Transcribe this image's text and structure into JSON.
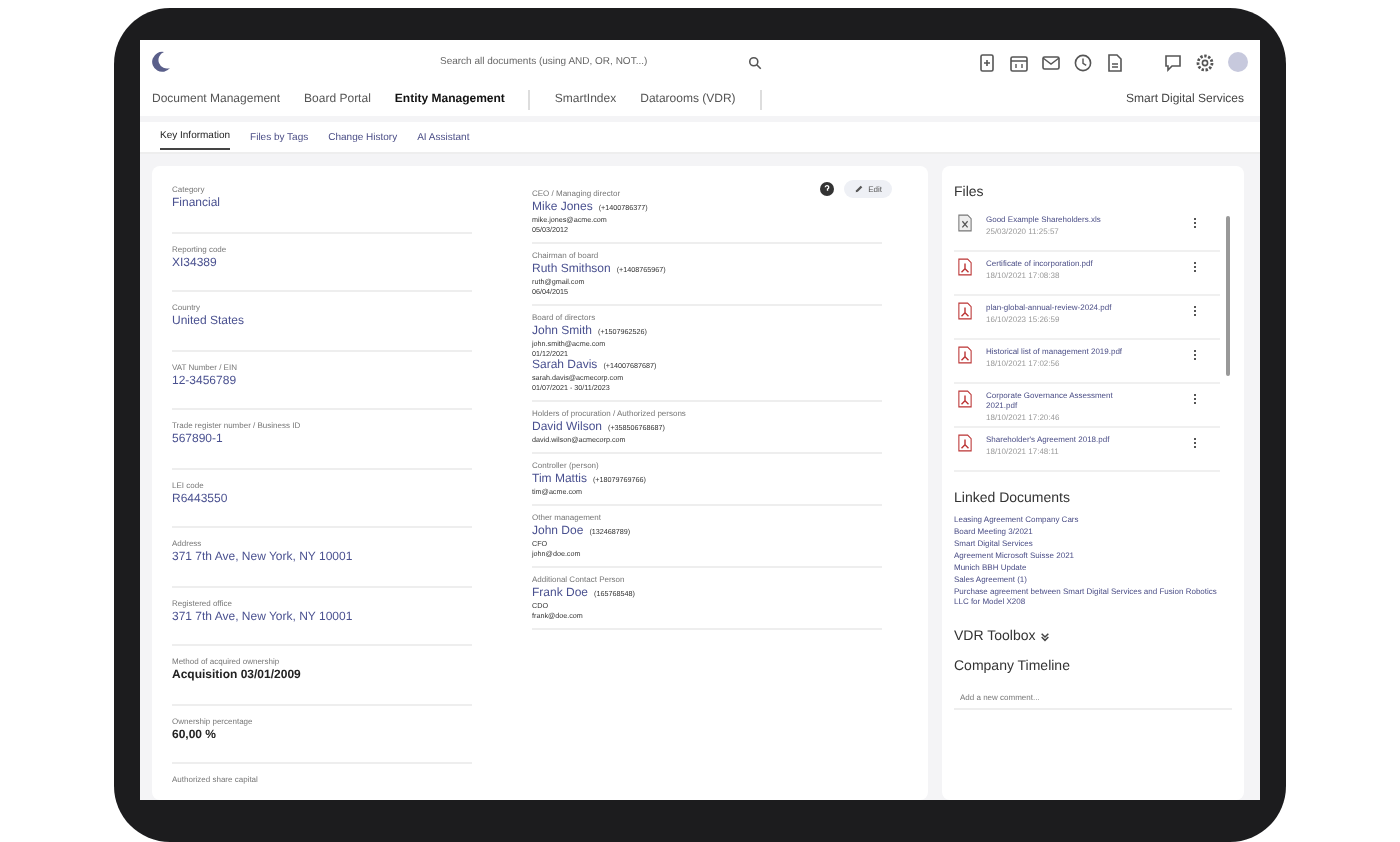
{
  "topbar": {
    "search": {
      "placeholder": "Search all documents (using AND, OR, NOT...)"
    },
    "company": "Smart Digital Services"
  },
  "nav": [
    {
      "label": "Document Management",
      "selected": false
    },
    {
      "label": "Board Portal",
      "selected": false
    },
    {
      "label": "Entity Management",
      "selected": true
    },
    {
      "label": "SmartIndex",
      "selected": false
    },
    {
      "label": "Datarooms (VDR)",
      "selected": false
    }
  ],
  "subtabs": [
    {
      "label": "Key Information",
      "selected": true
    },
    {
      "label": "Files by Tags",
      "selected": false
    },
    {
      "label": "Change History",
      "selected": false
    },
    {
      "label": "AI Assistant",
      "selected": false
    }
  ],
  "fields": [
    {
      "label": "Category",
      "value": "Financial",
      "kind": "link"
    },
    {
      "label": "Reporting code",
      "value": "XI34389",
      "kind": "link"
    },
    {
      "label": "Country",
      "value": "United States",
      "kind": "link"
    },
    {
      "label": "VAT Number / EIN",
      "value": "12-3456789",
      "kind": "link"
    },
    {
      "label": "Trade register number / Business ID",
      "value": "567890-1",
      "kind": "link"
    },
    {
      "label": "LEI code",
      "value": "R6443550",
      "kind": "link"
    },
    {
      "label": "Address",
      "value": "371 7th Ave, New York, NY 10001",
      "kind": "link"
    },
    {
      "label": "Registered office",
      "value": "371 7th Ave, New York, NY 10001",
      "kind": "link"
    },
    {
      "label": "Method of acquired ownership",
      "value": "Acquisition 03/01/2009",
      "kind": "plain"
    },
    {
      "label": "Ownership percentage",
      "value": "60,00 %",
      "kind": "plain"
    },
    {
      "label": "Authorized share capital"
    }
  ],
  "edit_button": "Edit",
  "roles": [
    {
      "label": "CEO / Managing director",
      "people": [
        {
          "name": "Mike Jones",
          "phone": "(+1400786377)",
          "lines": [
            "mike.jones@acme.com",
            "05/03/2012"
          ]
        }
      ]
    },
    {
      "label": "Chairman of board",
      "people": [
        {
          "name": "Ruth Smithson",
          "phone": "(+1408765967)",
          "lines": [
            "ruth@gmail.com",
            "06/04/2015"
          ]
        }
      ]
    },
    {
      "label": "Board of directors",
      "people": [
        {
          "name": "John Smith",
          "phone": "(+1507962526)",
          "lines": [
            "john.smith@acme.com",
            "01/12/2021"
          ]
        },
        {
          "name": "Sarah Davis",
          "phone": "(+14007687687)",
          "lines": [
            "sarah.davis@acmecorp.com",
            "01/07/2021 - 30/11/2023"
          ]
        }
      ]
    },
    {
      "label": "Holders of procuration / Authorized persons",
      "people": [
        {
          "name": "David Wilson",
          "phone": "(+358506768687)",
          "lines": [
            "david.wilson@acmecorp.com"
          ]
        }
      ]
    },
    {
      "label": "Controller (person)",
      "people": [
        {
          "name": "Tim Mattis",
          "phone": "(+18079769766)",
          "lines": [
            "tim@acme.com"
          ]
        }
      ]
    },
    {
      "label": "Other management",
      "people": [
        {
          "name": "John Doe",
          "phone": "(132468789)",
          "lines": [
            "CFO",
            "john@doe.com"
          ]
        }
      ]
    },
    {
      "label": "Additional Contact Person",
      "people": [
        {
          "name": "Frank Doe",
          "phone": "(165768548)",
          "lines": [
            "CDO",
            "frank@doe.com"
          ]
        }
      ]
    }
  ],
  "files": {
    "title": "Files",
    "items": [
      {
        "name": "Good Example Shareholders.xls",
        "date": "25/03/2020 11:25:57",
        "kind": "xls"
      },
      {
        "name": "Certificate of incorporation.pdf",
        "date": "18/10/2021 17:08:38",
        "kind": "pdf"
      },
      {
        "name": "plan-global-annual-review-2024.pdf",
        "date": "16/10/2023 15:26:59",
        "kind": "pdf"
      },
      {
        "name": "Historical list of management 2019.pdf",
        "date": "18/10/2021 17:02:56",
        "kind": "pdf"
      },
      {
        "name": "Corporate Governance Assessment 2021.pdf",
        "date": "18/10/2021 17:20:46",
        "kind": "pdf"
      },
      {
        "name": "Shareholder's Agreement 2018.pdf",
        "date": "18/10/2021 17:48:11",
        "kind": "pdf"
      }
    ]
  },
  "linked_documents": {
    "title": "Linked Documents",
    "items": [
      "Leasing Agreement Company Cars",
      "Board Meeting 3/2021",
      "Smart Digital Services",
      "Agreement Microsoft Suisse 2021",
      "Munich BBH Update",
      "Sales Agreement (1)",
      "Purchase agreement between Smart Digital Services and Fusion Robotics LLC for Model X208"
    ]
  },
  "vdr_toolbox": {
    "title": "VDR Toolbox",
    "expanded": false
  },
  "timeline": {
    "title": "Company Timeline",
    "comment": {
      "placeholder": "Add a new comment..."
    }
  }
}
